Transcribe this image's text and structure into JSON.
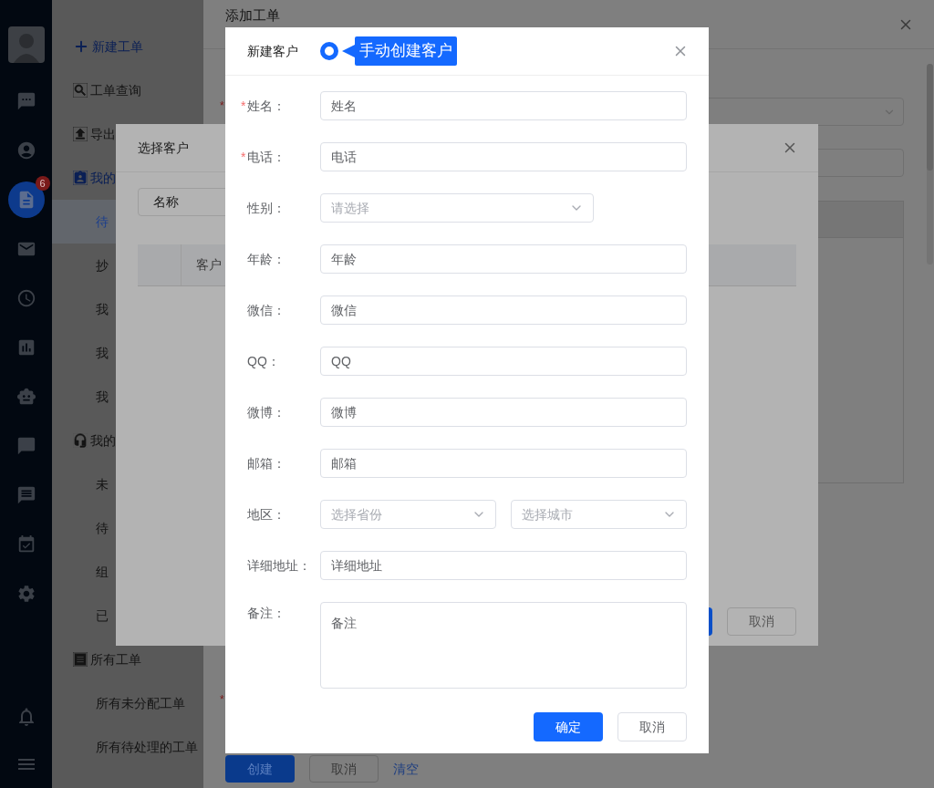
{
  "rail": {
    "items": [
      {
        "kind": "chat",
        "selected": false
      },
      {
        "kind": "contact",
        "selected": false
      },
      {
        "kind": "ticket",
        "selected": true,
        "badge": "6"
      },
      {
        "kind": "mail",
        "selected": false
      },
      {
        "kind": "history",
        "selected": false
      },
      {
        "kind": "report",
        "selected": false
      },
      {
        "kind": "bot",
        "selected": false
      },
      {
        "kind": "bubble",
        "selected": false
      },
      {
        "kind": "message",
        "selected": false
      },
      {
        "kind": "calendar",
        "selected": false
      },
      {
        "kind": "settings",
        "selected": false
      }
    ],
    "bottom_items": [
      {
        "kind": "bell"
      },
      {
        "kind": "menu"
      }
    ]
  },
  "nav": [
    {
      "label": "新建工单",
      "kind": "create"
    },
    {
      "label": "工单查询",
      "kind": "search"
    },
    {
      "label": "导出",
      "kind": "export"
    },
    {
      "label": "我的",
      "kind": "mine",
      "selected": true,
      "children": [
        {
          "label": "待",
          "selected": true
        },
        {
          "label": "抄",
          "selected": false
        },
        {
          "label": "我",
          "selected": false
        },
        {
          "label": "我",
          "selected": false
        },
        {
          "label": "我",
          "selected": false
        }
      ]
    },
    {
      "label": "我的",
      "kind": "agent",
      "selected": false,
      "children": [
        {
          "label": "未",
          "selected": false
        },
        {
          "label": "待",
          "selected": false
        },
        {
          "label": "组",
          "selected": false
        },
        {
          "label": "已",
          "selected": false
        }
      ]
    },
    {
      "label": "所有工单",
      "kind": "all",
      "selected": false,
      "children": [
        {
          "label": "所有未分配工单",
          "selected": false
        },
        {
          "label": "所有待处理的工单",
          "selected": false
        }
      ]
    }
  ],
  "main_window": {
    "title": "添加工单",
    "fields": [
      {
        "kind": "select",
        "required_mark": "*"
      },
      {
        "kind": "input"
      },
      {
        "kind": "table"
      },
      {
        "kind": "hidden",
        "required_mark": "*"
      }
    ],
    "buttons": [
      {
        "label": "创建",
        "kind": "primary"
      },
      {
        "label": "取消",
        "kind": "default"
      },
      {
        "label": "清空",
        "kind": "link"
      }
    ]
  },
  "select_customer_dialog": {
    "title": "选择客户",
    "search_field": {
      "value": "名称"
    },
    "table": {
      "columns": [
        "客户"
      ]
    },
    "buttons": [
      {
        "kind": "primary"
      },
      {
        "label": "取消",
        "kind": "default"
      }
    ]
  },
  "new_customer_dialog": {
    "title": "新建客户",
    "annotation": "手动创建客户",
    "fields": [
      {
        "label": "姓名：",
        "required_mark": "*",
        "kind": "input",
        "placeholder": "姓名"
      },
      {
        "label": "电话：",
        "required_mark": "*",
        "kind": "input",
        "placeholder": "电话"
      },
      {
        "label": "性别：",
        "kind": "select",
        "placeholder": "请选择"
      },
      {
        "label": "年龄：",
        "kind": "input",
        "placeholder": "年龄"
      },
      {
        "label": "微信：",
        "kind": "input",
        "placeholder": "微信"
      },
      {
        "label": "QQ：",
        "kind": "input",
        "placeholder": "QQ"
      },
      {
        "label": "微博：",
        "kind": "input",
        "placeholder": "微博"
      },
      {
        "label": "邮箱：",
        "kind": "input",
        "placeholder": "邮箱"
      },
      {
        "label": "地区：",
        "kind": "select_pair",
        "placeholders": [
          "选择省份",
          "选择城市"
        ]
      },
      {
        "label": "详细地址：",
        "kind": "input",
        "placeholder": "详细地址"
      },
      {
        "label": "备注：",
        "kind": "textarea",
        "placeholder": "备注"
      }
    ],
    "buttons": [
      {
        "label": "确定",
        "kind": "primary"
      },
      {
        "label": "取消",
        "kind": "default"
      }
    ]
  }
}
